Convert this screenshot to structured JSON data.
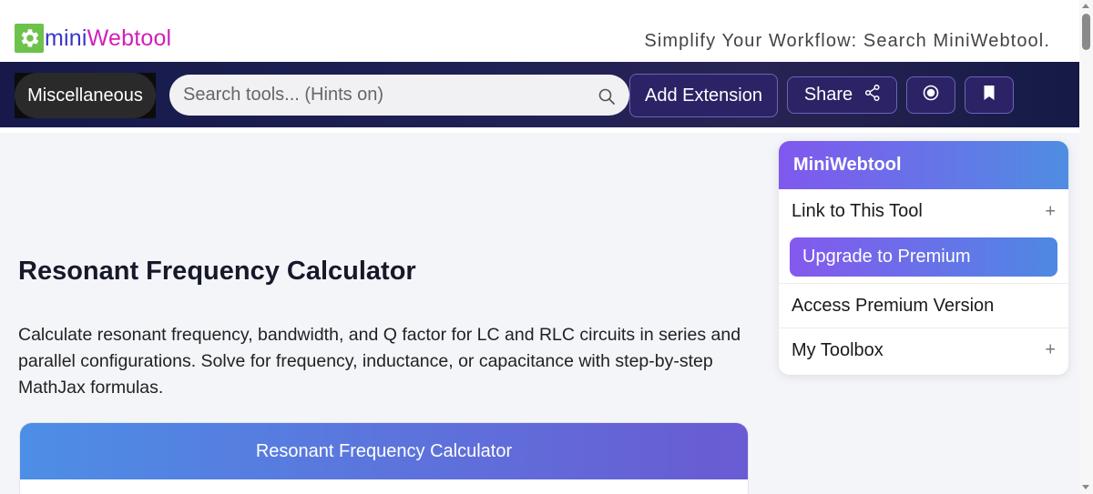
{
  "header": {
    "logo": {
      "part1": "mini",
      "part2": "Webtool",
      "icon": "gear-icon",
      "color_mini": "#3b35c8",
      "color_webtool": "#d21fb8",
      "icon_bg": "#6cc24a"
    },
    "tagline": "Simplify Your Workflow: Search MiniWebtool."
  },
  "nav": {
    "category_label": "Miscellaneous",
    "search": {
      "placeholder": "Search tools... (Hints on)",
      "value": "",
      "icon": "search-icon"
    },
    "add_extension_label": "Add Extension",
    "share_label": "Share",
    "share_icon": "share-icon",
    "record_icon": "record-icon",
    "bookmark_icon": "bookmark-icon"
  },
  "main": {
    "title": "Resonant Frequency Calculator",
    "description": "Calculate resonant frequency, bandwidth, and Q factor for LC and RLC circuits in series and parallel configurations. Solve for frequency, inductance, or capacitance with step-by-step MathJax formulas.",
    "calculator_header": "Resonant Frequency Calculator"
  },
  "sidebar": {
    "header": "MiniWebtool",
    "items": [
      {
        "label": "Link to This Tool",
        "expandable": true
      },
      {
        "label": "Upgrade to Premium",
        "highlighted": true
      },
      {
        "label": "Access Premium Version",
        "expandable": false
      },
      {
        "label": "My Toolbox",
        "expandable": true
      }
    ],
    "expand_symbol": "+"
  },
  "colors": {
    "nav_bg": "#1f2154",
    "accent_purple": "#6a5bd3",
    "accent_blue": "#4d8ee6",
    "page_bg": "#f4f5f9"
  }
}
